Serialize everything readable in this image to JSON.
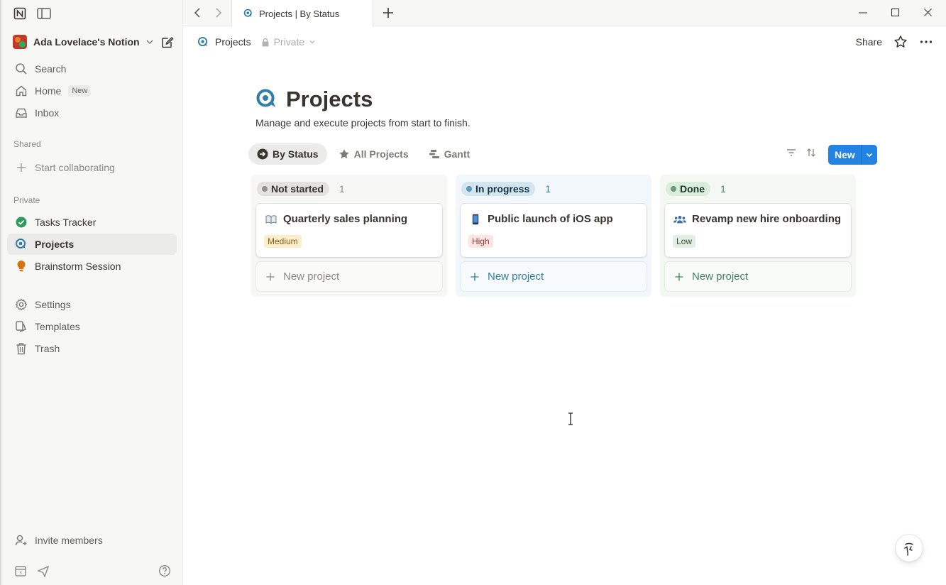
{
  "window": {
    "tab_title": "Projects | By Status"
  },
  "sidebar": {
    "workspace_name": "Ada Lovelace's Notion",
    "top_items": [
      {
        "label": "Search"
      },
      {
        "label": "Home",
        "badge": "New"
      },
      {
        "label": "Inbox"
      }
    ],
    "shared_label": "Shared",
    "start_collaborating": "Start collaborating",
    "private_label": "Private",
    "private_items": [
      {
        "label": "Tasks Tracker",
        "icon": "check-circle-icon",
        "color": "#2b9b5e"
      },
      {
        "label": "Projects",
        "icon": "projects-icon",
        "color": "#337ea9",
        "active": true
      },
      {
        "label": "Brainstorm Session",
        "icon": "lightbulb-icon",
        "color": "#d9730d"
      }
    ],
    "utility_items": [
      {
        "label": "Settings"
      },
      {
        "label": "Templates"
      },
      {
        "label": "Trash"
      }
    ],
    "invite_members": "Invite members"
  },
  "header": {
    "breadcrumb": "Projects",
    "privacy": "Private",
    "share": "Share"
  },
  "page": {
    "title": "Projects",
    "description": "Manage and execute projects from start to finish.",
    "views": [
      {
        "label": "By Status",
        "active": true
      },
      {
        "label": "All Projects"
      },
      {
        "label": "Gantt"
      }
    ],
    "new_button": "New"
  },
  "board": {
    "columns": [
      {
        "status": "Not started",
        "count": "1",
        "bg": "#f7f7f5",
        "pill_bg": "#e3e2e0",
        "pill_color": "#32302c",
        "dot": "#91918e",
        "accent": "#8b8a86",
        "card": {
          "title": "Quarterly sales planning",
          "icon": "book-icon",
          "priority": "Medium",
          "priority_bg": "#fbeecb",
          "priority_color": "#8a5b1a"
        },
        "new_label": "New project"
      },
      {
        "status": "In progress",
        "count": "1",
        "bg": "#f1f7fb",
        "pill_bg": "#d3e5ef",
        "pill_color": "#183347",
        "dot": "#5b97bd",
        "accent": "#337ea9",
        "card": {
          "title": "Public launch of iOS app",
          "icon": "phone-icon",
          "priority": "High",
          "priority_bg": "#fbe4e4",
          "priority_color": "#8b3a33"
        },
        "new_label": "New project"
      },
      {
        "status": "Done",
        "count": "1",
        "bg": "#f4f8f3",
        "pill_bg": "#dbeddb",
        "pill_color": "#1c3829",
        "dot": "#6c9b7d",
        "accent": "#448361",
        "card": {
          "title": "Revamp new hire onboarding",
          "icon": "people-icon",
          "priority": "Low",
          "priority_bg": "#e3ede4",
          "priority_color": "#2f5238"
        },
        "new_label": "New project"
      }
    ]
  }
}
